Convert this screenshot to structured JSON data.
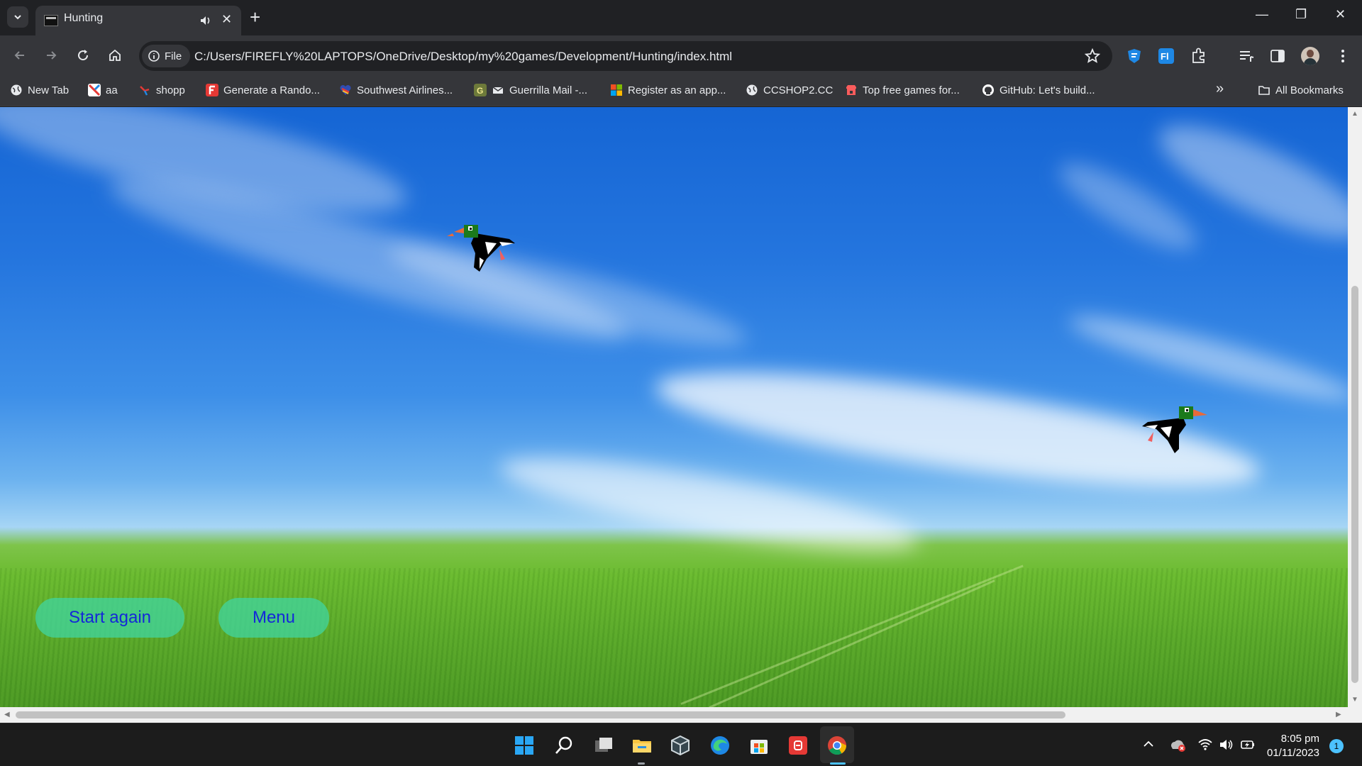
{
  "browser": {
    "tab_title": "Hunting",
    "new_tab_symbol": "+",
    "url_chip": "File",
    "url": "C:/Users/FIREFLY%20LAPTOPS/OneDrive/Desktop/my%20games/Development/Hunting/index.html",
    "bookmarks": [
      {
        "label": "New Tab",
        "icon": "globe-icon",
        "color": "#e8eaed"
      },
      {
        "label": "aa",
        "icon": "aa-favicon",
        "color": "#e53935"
      },
      {
        "label": "shopp",
        "icon": "shopp-favicon",
        "color": "#e53935"
      },
      {
        "label": "Generate a Rando...",
        "icon": "f-favicon",
        "color": "#e53935"
      },
      {
        "label": "Southwest Airlines...",
        "icon": "heart-favicon",
        "color": "#304cb2"
      },
      {
        "label": "Guerrilla Mail -...",
        "icon": "guerrilla-favicon",
        "color": "#6d7a3a"
      },
      {
        "label": "Register as an app...",
        "icon": "microsoft-favicon",
        "color": "#f25022"
      },
      {
        "label": "CCSHOP2.CC",
        "icon": "globe-icon",
        "color": "#e8eaed"
      },
      {
        "label": "Top free games for...",
        "icon": "itch-favicon",
        "color": "#fa5c5c"
      },
      {
        "label": "GitHub: Let's build...",
        "icon": "github-favicon",
        "color": "#ffffff"
      }
    ],
    "more_bookmarks_symbol": "»",
    "all_bookmarks": "All Bookmarks"
  },
  "game": {
    "start_again_label": "Start again",
    "menu_label": "Menu",
    "sky_color": "#1f6fdc",
    "grass_color": "#5aa829",
    "button_color": "#40d6a0",
    "button_text_color": "#1428d8",
    "ducks": [
      {
        "name": "duck-left",
        "facing": "left"
      },
      {
        "name": "duck-right",
        "facing": "right"
      }
    ]
  },
  "taskbar": {
    "time": "8:05 pm",
    "date": "01/11/2023",
    "notification_count": "1",
    "pinned": [
      "start-icon",
      "search-icon",
      "task-view-icon",
      "file-explorer-icon",
      "virtualbox-icon",
      "edge-icon",
      "store-icon",
      "app-red-icon",
      "chrome-icon"
    ]
  }
}
